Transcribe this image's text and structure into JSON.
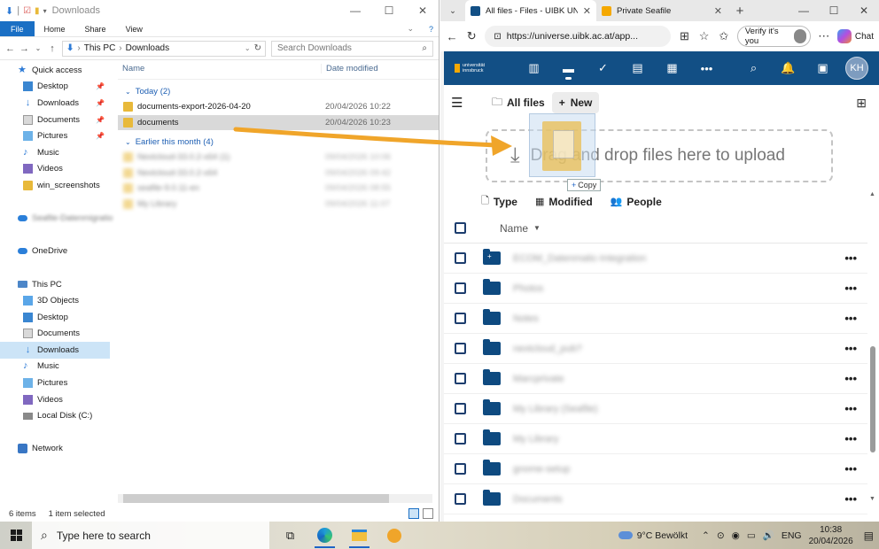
{
  "explorer": {
    "title": "Downloads",
    "ribbon": [
      "File",
      "Home",
      "Share",
      "View"
    ],
    "breadcrumb": [
      "This PC",
      "Downloads"
    ],
    "search_placeholder": "Search Downloads",
    "columns": {
      "name": "Name",
      "date": "Date modified"
    },
    "nav": [
      {
        "label": "Quick access",
        "icon": "star-icon",
        "indent": 1,
        "pinned": false
      },
      {
        "label": "Desktop",
        "icon": "folder-blue-icon",
        "indent": 2,
        "pinned": true
      },
      {
        "label": "Downloads",
        "icon": "download-icon",
        "indent": 2,
        "pinned": true
      },
      {
        "label": "Documents",
        "icon": "document-icon",
        "indent": 2,
        "pinned": true
      },
      {
        "label": "Pictures",
        "icon": "pictures-icon",
        "indent": 2,
        "pinned": true
      },
      {
        "label": "Music",
        "icon": "music-icon",
        "indent": 2,
        "pinned": false
      },
      {
        "label": "Videos",
        "icon": "videos-icon",
        "indent": 2,
        "pinned": false
      },
      {
        "label": "win_screenshots",
        "icon": "folder-icon",
        "indent": 2,
        "pinned": false
      },
      {
        "label": "",
        "icon": "",
        "indent": 0,
        "pinned": false
      },
      {
        "label": "Seafile-Datenmigratio",
        "icon": "seafile-icon",
        "indent": 1,
        "pinned": false,
        "blurred": true
      },
      {
        "label": "",
        "icon": "",
        "indent": 0,
        "pinned": false
      },
      {
        "label": "OneDrive",
        "icon": "cloud-icon",
        "indent": 1,
        "pinned": false
      },
      {
        "label": "",
        "icon": "",
        "indent": 0,
        "pinned": false
      },
      {
        "label": "This PC",
        "icon": "pc-icon",
        "indent": 1,
        "pinned": false
      },
      {
        "label": "3D Objects",
        "icon": "3d-objects-icon",
        "indent": 2,
        "pinned": false
      },
      {
        "label": "Desktop",
        "icon": "folder-blue-icon",
        "indent": 2,
        "pinned": false
      },
      {
        "label": "Documents",
        "icon": "document-icon",
        "indent": 2,
        "pinned": false
      },
      {
        "label": "Downloads",
        "icon": "download-icon",
        "indent": 2,
        "pinned": false,
        "selected": true
      },
      {
        "label": "Music",
        "icon": "music-icon",
        "indent": 2,
        "pinned": false
      },
      {
        "label": "Pictures",
        "icon": "pictures-icon",
        "indent": 2,
        "pinned": false
      },
      {
        "label": "Videos",
        "icon": "videos-icon",
        "indent": 2,
        "pinned": false
      },
      {
        "label": "Local Disk (C:)",
        "icon": "disk-icon",
        "indent": 2,
        "pinned": false
      },
      {
        "label": "",
        "icon": "",
        "indent": 0,
        "pinned": false
      },
      {
        "label": "Network",
        "icon": "network-icon",
        "indent": 1,
        "pinned": false
      }
    ],
    "groups": [
      {
        "label": "Today (2)",
        "files": [
          {
            "name": "documents-export-2026-04-20",
            "date": "20/04/2026 10:22",
            "selected": false,
            "blurred": false
          },
          {
            "name": "documents",
            "date": "20/04/2026 10:23",
            "selected": true,
            "blurred": false
          }
        ]
      },
      {
        "label": "Earlier this month (4)",
        "files": [
          {
            "name": "Nextcloud-33.0.2-x64 (1)",
            "date": "09/04/2026 10:06",
            "selected": false,
            "blurred": true
          },
          {
            "name": "Nextcloud-33.0.2-x64",
            "date": "09/04/2026 09:42",
            "selected": false,
            "blurred": true
          },
          {
            "name": "seafile-9.0.11-en",
            "date": "09/04/2026 08:55",
            "selected": false,
            "blurred": true
          },
          {
            "name": "My Library",
            "date": "09/04/2026 11:07",
            "selected": false,
            "blurred": true
          }
        ]
      }
    ],
    "status": {
      "items": "6 items",
      "selected": "1 item selected"
    }
  },
  "browser": {
    "tabs": [
      {
        "title": "All files - Files - UIBK UNI",
        "active": true
      },
      {
        "title": "Private Seafile",
        "active": false
      }
    ],
    "url": "https://universe.uibk.ac.at/app...",
    "verify_label": "Verify it's you",
    "chat_label": "Chat",
    "nextcloud": {
      "logo_line1": "universität",
      "logo_line2": "innsbruck",
      "avatar": "KH",
      "breadcrumb": "All files",
      "new_label": "New",
      "drop_text": "Drag and drop files here to upload",
      "filters": [
        "Type",
        "Modified",
        "People"
      ],
      "column_name": "Name",
      "folders": [
        {
          "name": "ECOM_Datenmatic-Integration",
          "shared": true
        },
        {
          "name": "Photos",
          "shared": false
        },
        {
          "name": "Notes",
          "shared": false
        },
        {
          "name": "nextcloud_pub?",
          "shared": false
        },
        {
          "name": "Marcprivate",
          "shared": false
        },
        {
          "name": "My Library (Seafile)",
          "shared": false
        },
        {
          "name": "My Library",
          "shared": false
        },
        {
          "name": "gnome-setup",
          "shared": false
        },
        {
          "name": "Documents",
          "shared": false
        }
      ]
    }
  },
  "drag": {
    "copy_label": "Copy"
  },
  "taskbar": {
    "search_placeholder": "Type here to search",
    "weather": "9°C  Bewölkt",
    "language": "ENG",
    "time": "10:38",
    "date": "20/04/2026"
  },
  "colors": {
    "nextcloud_primary": "#124f85",
    "drag_arrow": "#f0a52a",
    "explorer_accent": "#1a6fc4"
  }
}
